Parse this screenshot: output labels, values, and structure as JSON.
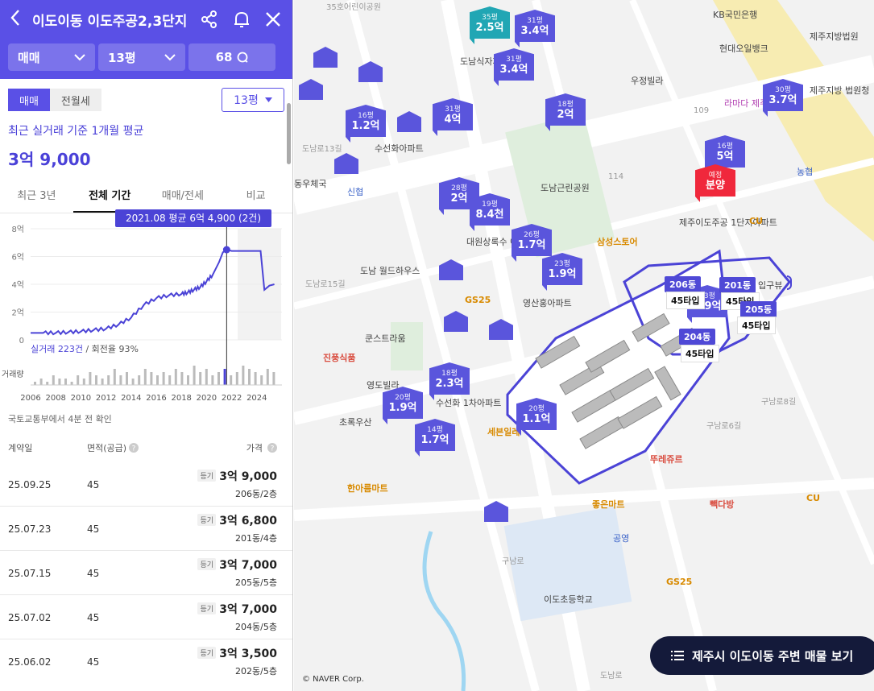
{
  "header": {
    "title": "이도이동 이도주공2,3단지",
    "filters": [
      {
        "label": "매매"
      },
      {
        "label": "13평"
      },
      {
        "label": "68"
      }
    ]
  },
  "toggles": {
    "items": [
      "매매",
      "전월세"
    ],
    "active": 0,
    "size_select": "13평"
  },
  "summary": {
    "label": "최근 실거래 기준 1개월 평균",
    "value": "3억 9,000"
  },
  "period_tabs": {
    "items": [
      "최근 3년",
      "전체 기간",
      "매매/전세",
      "비교"
    ],
    "active": 1
  },
  "chart_data": {
    "type": "line",
    "title": "",
    "tooltip": "2021.08 평균 6억 4,900 (2건)",
    "ylabel": "",
    "y_ticks": [
      "8억",
      "6억",
      "4억",
      "2억",
      "0"
    ],
    "ylim": [
      0,
      8
    ],
    "x_ticks": [
      "2006",
      "2008",
      "2010",
      "2012",
      "2014",
      "2016",
      "2018",
      "2020",
      "2022",
      "2024"
    ],
    "xlim": [
      2006,
      2026
    ],
    "series": [
      {
        "x": [
          2006,
          2007,
          2008,
          2009,
          2010,
          2011,
          2012,
          2013,
          2014,
          2015,
          2016,
          2017,
          2018,
          2018.5,
          2019,
          2019.5,
          2020,
          2020.5,
          2021,
          2021.3,
          2021.6,
          2022,
          2023,
          2024.3,
          2024.6,
          2025,
          2025.4
        ],
        "y": [
          0.5,
          0.5,
          0.5,
          0.55,
          0.6,
          0.7,
          0.8,
          1.1,
          1.6,
          2.5,
          3.0,
          3.2,
          3.3,
          3.4,
          3.6,
          3.8,
          4.2,
          4.7,
          5.6,
          6.3,
          6.5,
          6.4,
          6.4,
          6.4,
          3.6,
          3.9,
          4.0
        ]
      }
    ],
    "highlight": {
      "x": 2021.6,
      "y": 6.49
    },
    "footer": {
      "count_label": "실거래 223건",
      "rate_label": " / 회전율 93%"
    },
    "volume_label": "거래량",
    "volume": [
      1,
      2,
      1,
      3,
      2,
      2,
      1,
      3,
      2,
      4,
      3,
      2,
      3,
      5,
      3,
      4,
      2,
      3,
      5,
      4,
      3,
      4,
      3,
      5,
      4,
      3,
      6,
      4,
      5,
      3,
      4,
      5,
      3,
      4,
      6,
      5,
      4,
      3,
      5,
      4
    ]
  },
  "note": "국토교통부에서 4분 전 확인",
  "table": {
    "headers": [
      "계약일",
      "면적(공급)",
      "가격"
    ],
    "rows": [
      {
        "date": "25.09.25",
        "area": "45",
        "badge": "등기",
        "price": "3억 9,000",
        "unit": "206동/2층"
      },
      {
        "date": "25.07.23",
        "area": "45",
        "badge": "등기",
        "price": "3억 6,800",
        "unit": "201동/4층"
      },
      {
        "date": "25.07.15",
        "area": "45",
        "badge": "등기",
        "price": "3억 7,000",
        "unit": "205동/5층"
      },
      {
        "date": "25.07.02",
        "area": "45",
        "badge": "등기",
        "price": "3억 7,000",
        "unit": "204동/5층"
      },
      {
        "date": "25.06.02",
        "area": "45",
        "badge": "등기",
        "price": "3억 3,500",
        "unit": "202동/5층"
      }
    ]
  },
  "map": {
    "markers": [
      {
        "size": "35평",
        "price": "2.5억",
        "style": "teal"
      },
      {
        "size": "31평",
        "price": "3.4억"
      },
      {
        "size": "31평",
        "price": "3.4억"
      },
      {
        "size": "16평",
        "price": "1.2억"
      },
      {
        "size": "31평",
        "price": "4억"
      },
      {
        "size": "18평",
        "price": "2억"
      },
      {
        "size": "30평",
        "price": "3.7억"
      },
      {
        "size": "16평",
        "price": "5억"
      },
      {
        "size": "예정",
        "price": "분양",
        "style": "red"
      },
      {
        "size": "28평",
        "price": "2억"
      },
      {
        "size": "19평",
        "price": "8.4천"
      },
      {
        "size": "26평",
        "price": "1.7억"
      },
      {
        "size": "23평",
        "price": "1.9억"
      },
      {
        "size": "13평",
        "price": "3.9억"
      },
      {
        "size": "18평",
        "price": "2.3억"
      },
      {
        "size": "20평",
        "price": "1.9억"
      },
      {
        "size": "20평",
        "price": "1.1억"
      },
      {
        "size": "14평",
        "price": "1.7억"
      }
    ],
    "labels": [
      "35호어린이공원",
      "KB국민은행",
      "현대오일뱅크",
      "제주지방법원",
      "우정빌라",
      "도남식자재마트",
      "라마다 제주시티호텔",
      "제주지방 법원청",
      "수선화아파트",
      "도남로13길",
      "동우체국",
      "신협",
      "도남근린공원",
      "114",
      "109",
      "농협",
      "제주이도주공 1단지아파트",
      "CU",
      "삼성스토어",
      "도남 월드하우스",
      "GS25",
      "대원상록수 아파트",
      "영산홍아파트",
      "쿤스트라움",
      "진풍식품",
      "영도빌라",
      "수선화 1차아파트",
      "세븐일레",
      "초록우산",
      "한아름마트",
      "뚜레쥬르",
      "좋은마트",
      "빽다방",
      "공영",
      "이도초등학교",
      "GS25",
      "CU",
      "도남로15길",
      "도남로",
      "구남로",
      "구남로6길",
      "구남로8길",
      "입구뷰"
    ],
    "dong_badges": [
      {
        "dong": "206동",
        "type": "45타입"
      },
      {
        "dong": "201동",
        "type": "45타입"
      },
      {
        "dong": "205동",
        "type": "45타입"
      },
      {
        "dong": "204동",
        "type": "45타입"
      }
    ],
    "cta": "제주시 이도이동 주변 매물 보기",
    "copyright": "© NAVER Corp."
  },
  "colors": {
    "brand": "#5a50e6",
    "marker": "#5a55dc",
    "teal": "#21a6b4",
    "red": "#f0283c"
  }
}
